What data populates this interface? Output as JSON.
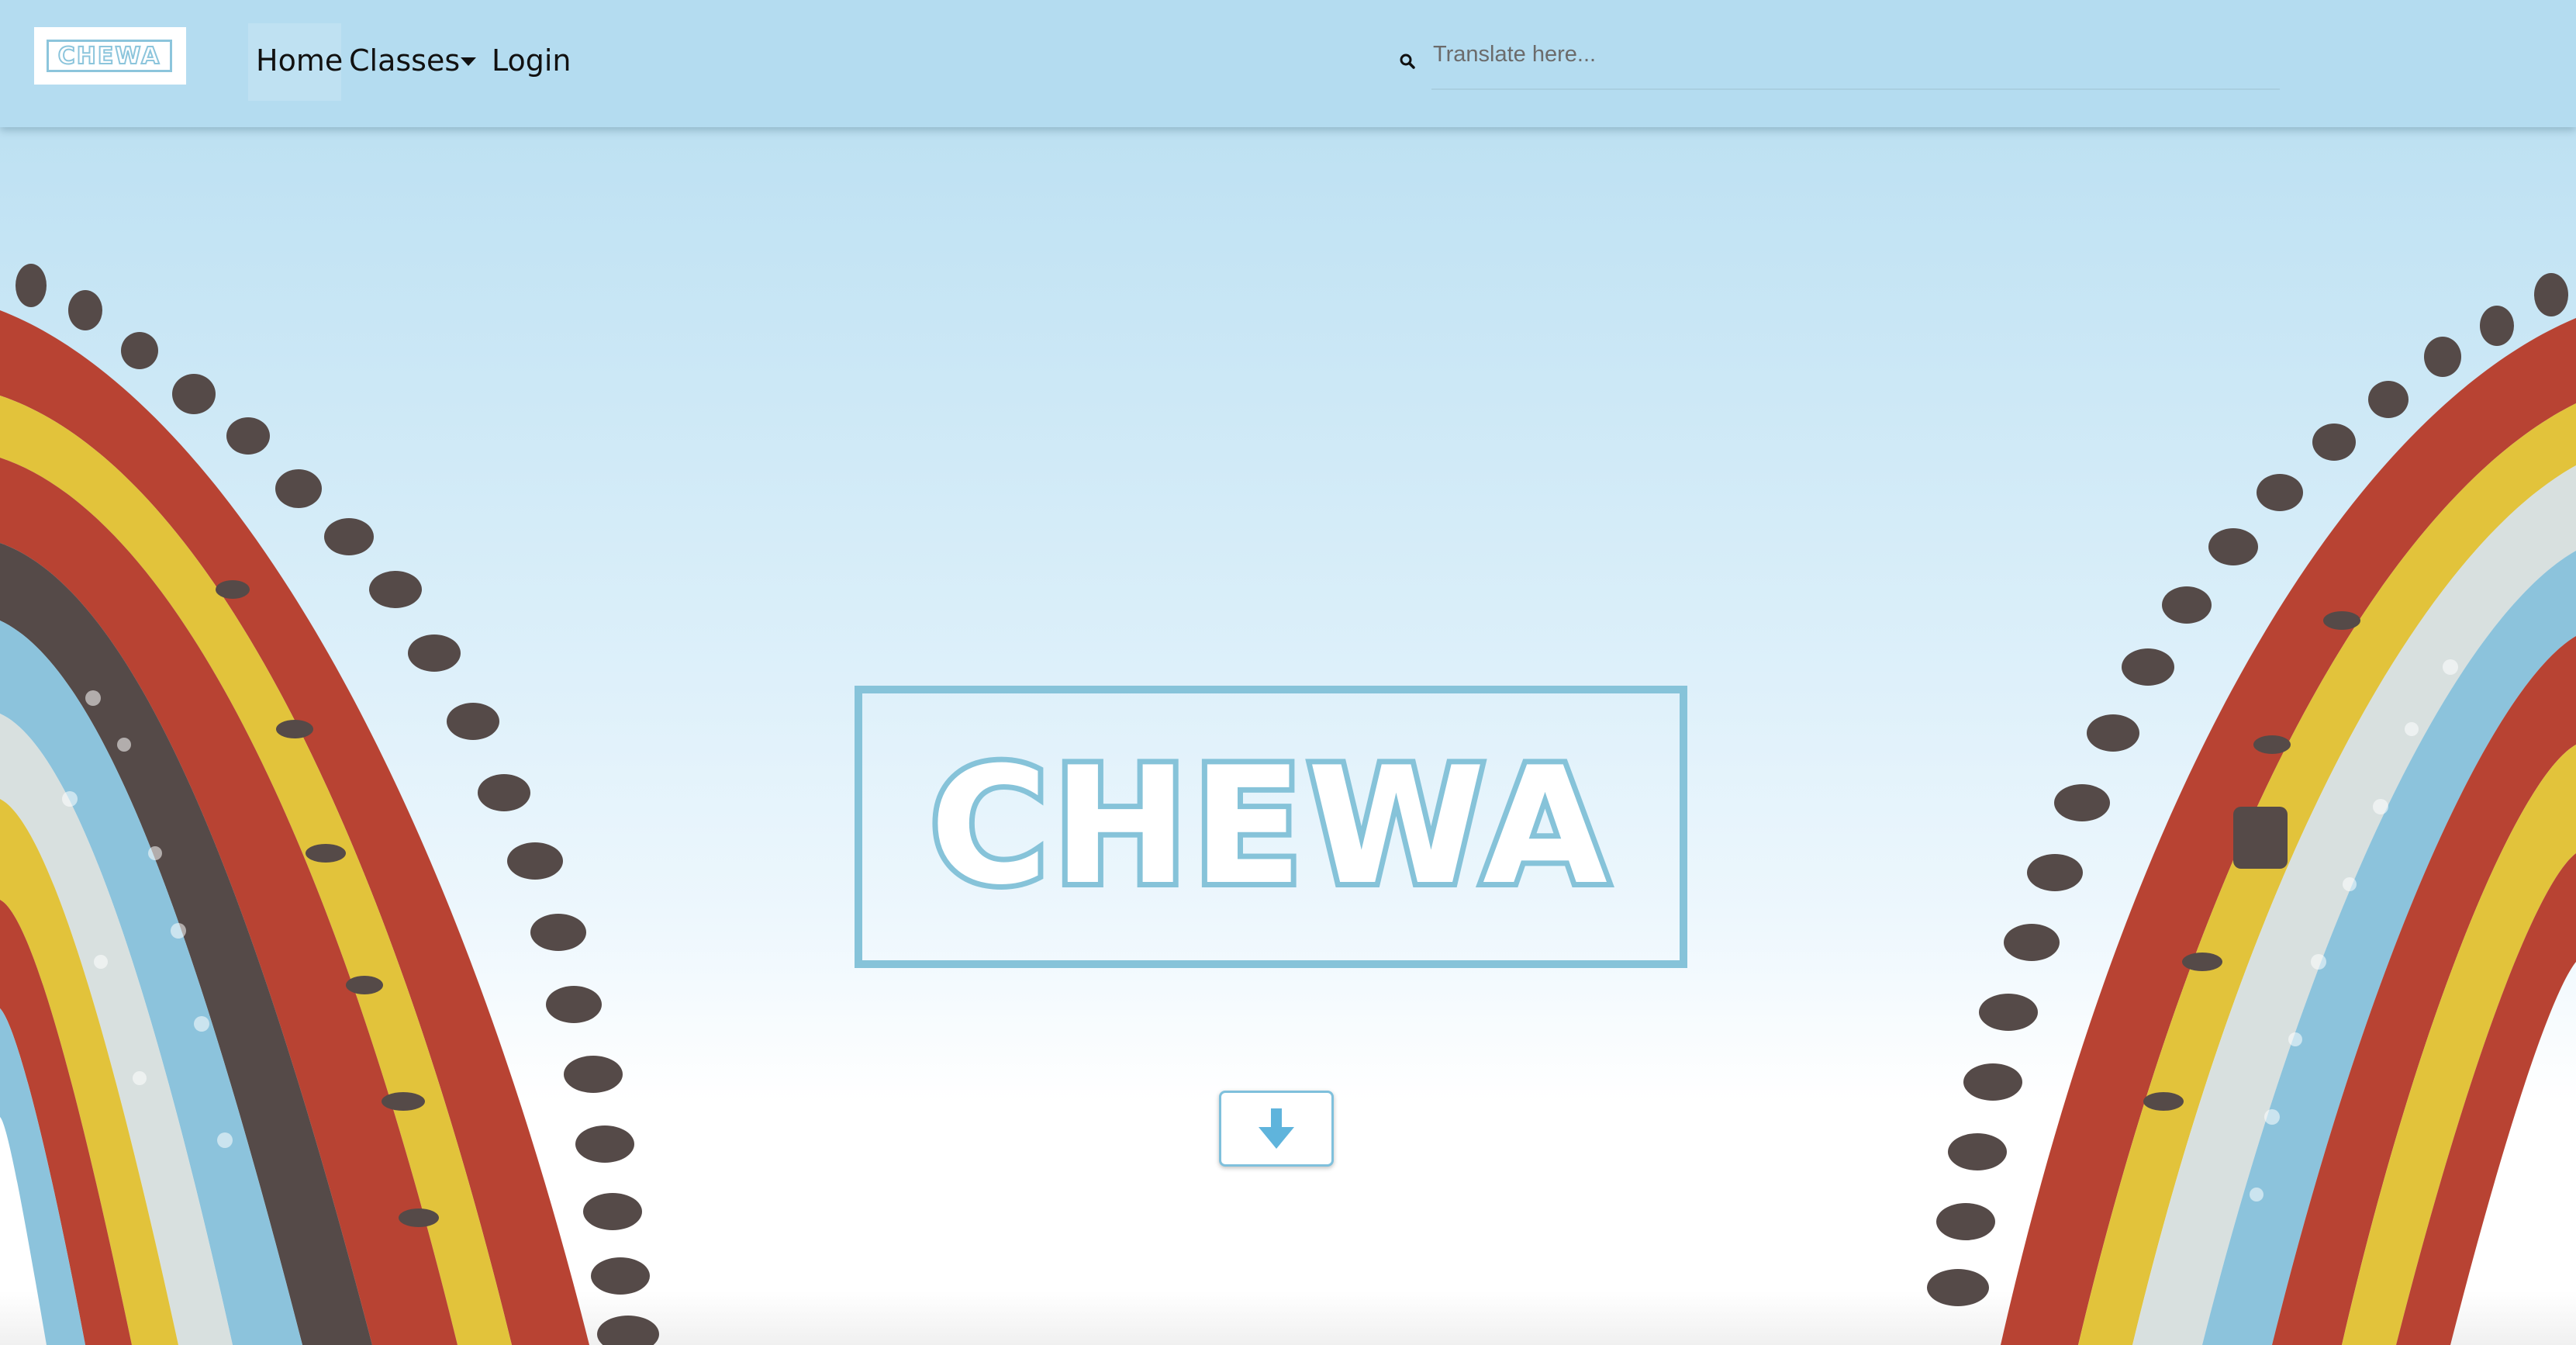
{
  "navbar": {
    "logo_text": "CHEWA",
    "links": {
      "home": "Home",
      "classes": "Classes",
      "login": "Login"
    },
    "search": {
      "placeholder": "Translate here...",
      "icon": "search-icon"
    }
  },
  "hero": {
    "title": "CHEWA",
    "scroll_button_icon": "arrow-down-icon"
  },
  "colors": {
    "navbar_bg": "#b4dcf0",
    "accent": "#86c3d9",
    "art_red": "#b84333",
    "art_yellow": "#e2c33b",
    "art_blue": "#8cc3dc",
    "art_grey": "#d8e0df",
    "art_dark": "#554a48"
  }
}
